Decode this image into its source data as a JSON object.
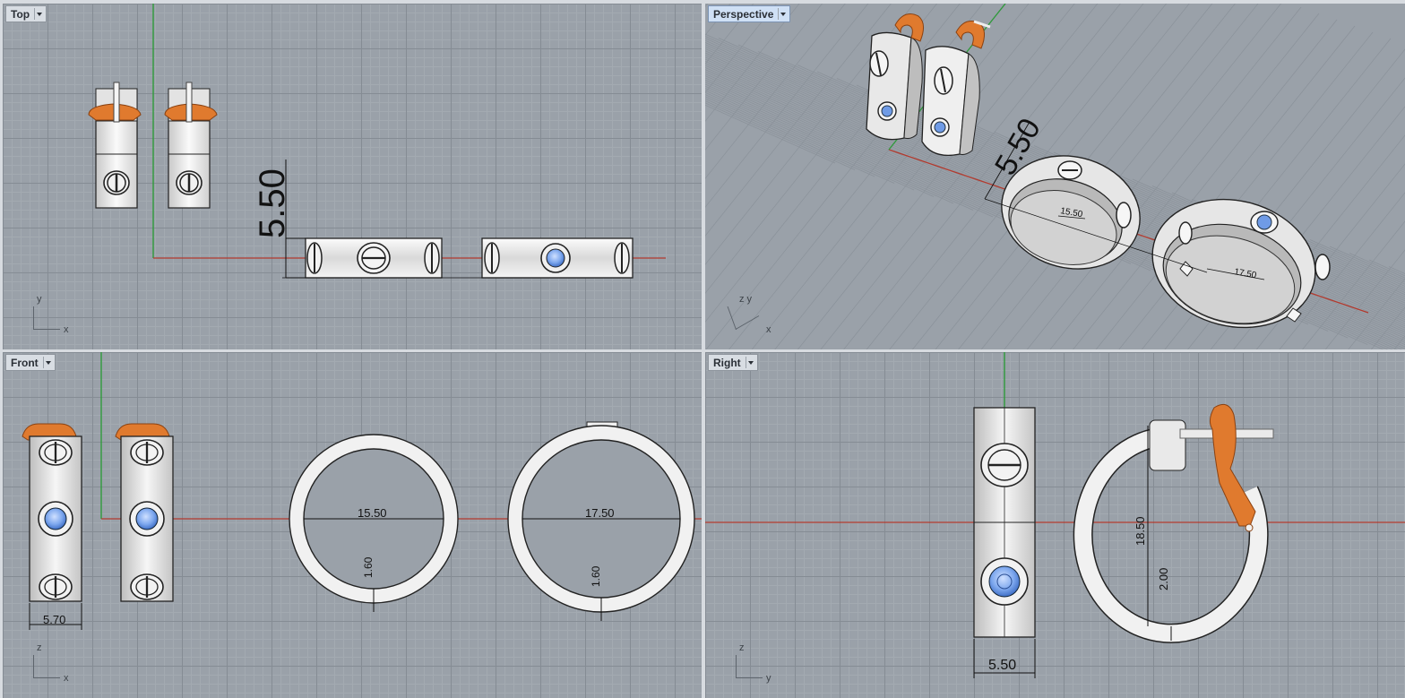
{
  "viewports": {
    "top": {
      "label": "Top",
      "axis_v": "y",
      "axis_h": "x"
    },
    "perspective": {
      "label": "Perspective",
      "axis_v": "z y",
      "axis_h": "x"
    },
    "front": {
      "label": "Front",
      "axis_v": "z",
      "axis_h": "x"
    },
    "right": {
      "label": "Right",
      "axis_v": "z",
      "axis_h": "y"
    }
  },
  "dimensions": {
    "ring_width": "5.50",
    "ring_small_diameter": "15.50",
    "ring_large_diameter": "17.50",
    "ring_thickness": "1.60",
    "earring_width": "5.70",
    "hoop_diameter": "18.50",
    "hoop_thickness": "2.00"
  },
  "colors": {
    "viewport_bg": "#9aa1a9",
    "grid_major": "#858c94",
    "grid_minor": "#a3aab1",
    "axis_x": "#b23a2e",
    "axis_y": "#2e9a3a",
    "metal": "#e9e9e9",
    "gem": "#6f9be6",
    "clip": "#e07a2e"
  }
}
